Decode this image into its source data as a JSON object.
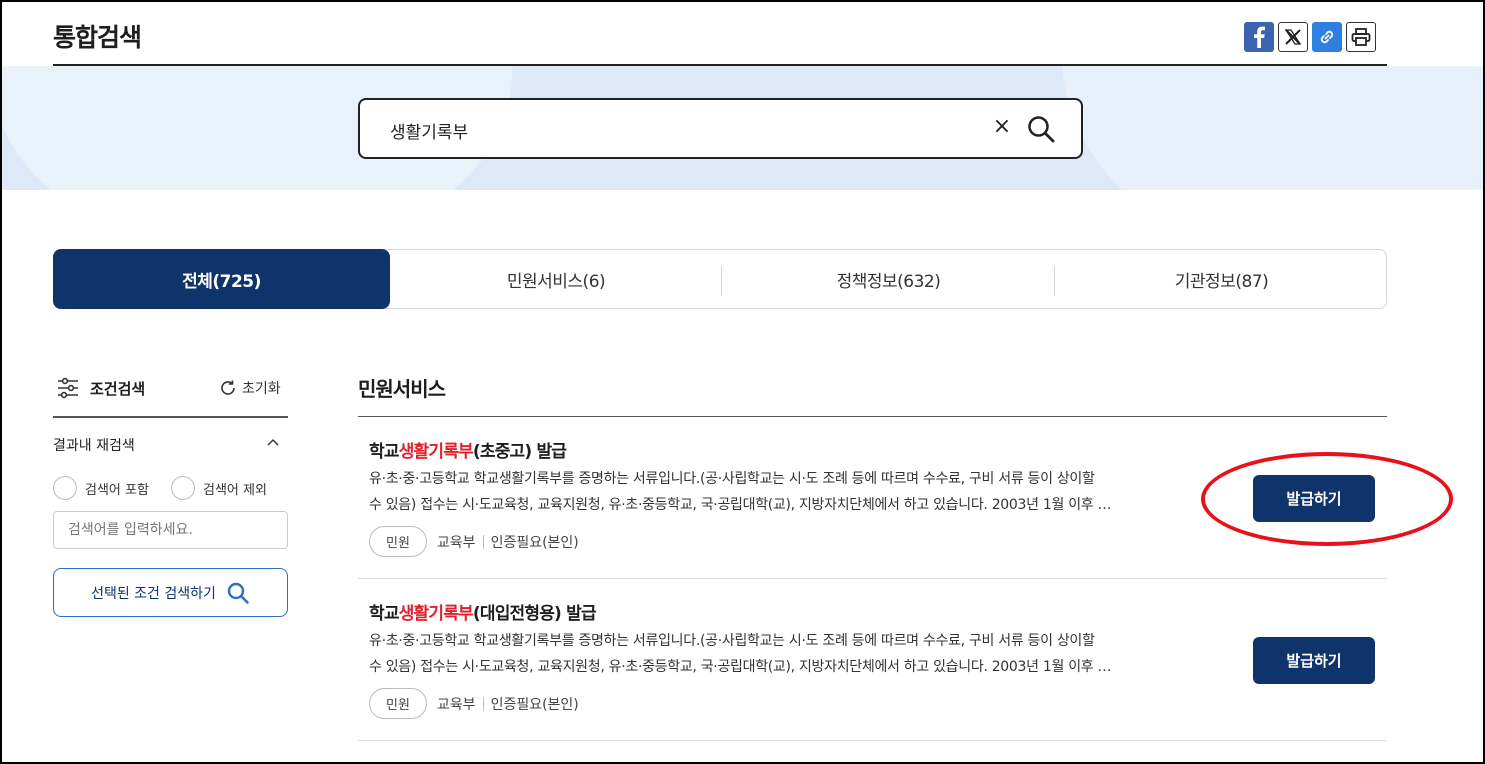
{
  "header": {
    "title": "통합검색"
  },
  "share": {
    "icons": [
      "facebook-icon",
      "x-icon",
      "link-icon",
      "print-icon"
    ]
  },
  "search": {
    "value": "생활기록부",
    "clear_label": "×"
  },
  "tabs": [
    {
      "label": "전체(725)",
      "active": true
    },
    {
      "label": "민원서비스(6)",
      "active": false
    },
    {
      "label": "정책정보(632)",
      "active": false
    },
    {
      "label": "기관정보(87)",
      "active": false
    }
  ],
  "filter": {
    "title": "조건검색",
    "reset_label": "초기화",
    "research_label": "결과내 재검색",
    "include_label": "검색어 포함",
    "exclude_label": "검색어 제외",
    "keyword_placeholder": "검색어를 입력하세요.",
    "submit_label": "선택된 조건 검색하기"
  },
  "results": {
    "section_title": "민원서비스",
    "items": [
      {
        "title_pre": "학교",
        "title_hl": "생활기록부",
        "title_post": "(초중고) 발급",
        "desc_line1": "유·초·중·고등학교 학교생활기록부를 증명하는 서류입니다.(공·사립학교는 시·도 조례 등에 따르며 수수료, 구비 서류 등이 상이할",
        "desc_line2": "수 있음) 접수는 시·도교육청, 교육지원청, 유·초·중등학교, 국·공립대학(교), 지방자치단체에서 하고 있습니다. 2003년 1월 이후 …",
        "badge": "민원",
        "org": "교육부",
        "auth": "인증필요(본인)",
        "button": "발급하기"
      },
      {
        "title_pre": "학교",
        "title_hl": "생활기록부",
        "title_post": "(대입전형용) 발급",
        "desc_line1": "유·초·중·고등학교 학교생활기록부를 증명하는 서류입니다.(공·사립학교는 시·도 조례 등에 따르며 수수료, 구비 서류 등이 상이할",
        "desc_line2": "수 있음) 접수는 시·도교육청, 교육지원청, 유·초·중등학교, 국·공립대학(교), 지방자치단체에서 하고 있습니다. 2003년 1월 이후 …",
        "badge": "민원",
        "org": "교육부",
        "auth": "인증필요(본인)",
        "button": "발급하기"
      }
    ]
  },
  "colors": {
    "primary": "#0f336b",
    "highlight": "#e0202b",
    "annotation": "#e8111a",
    "band": "#dde9f8"
  }
}
